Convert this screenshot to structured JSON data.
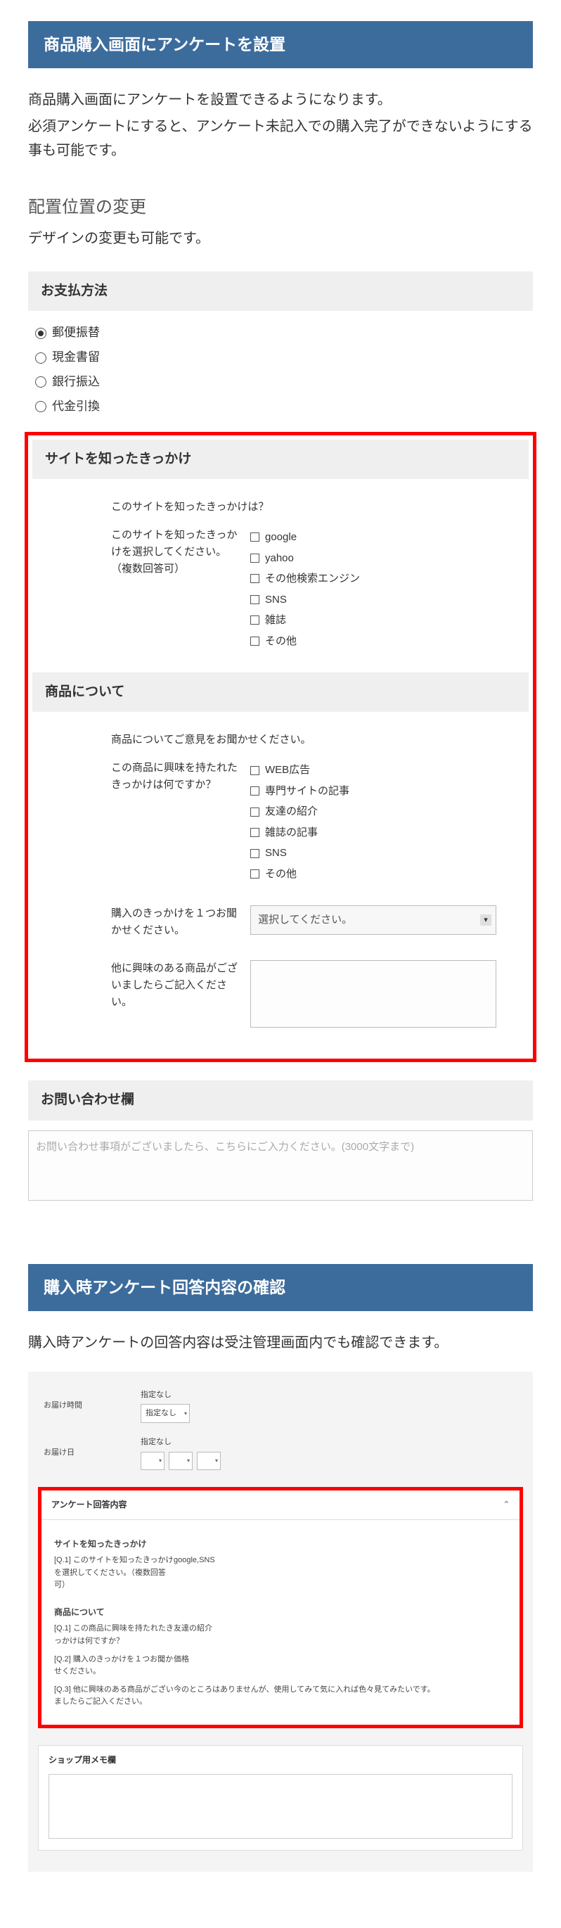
{
  "section1": {
    "title": "商品購入画面にアンケートを設置",
    "p1": "商品購入画面にアンケートを設置できるようになります。",
    "p2": "必須アンケートにすると、アンケート未記入での購入完了ができないようにする事も可能です。",
    "sub_head": "配置位置の変更",
    "sub_desc": "デザインの変更も可能です。"
  },
  "payment": {
    "title": "お支払方法",
    "options": [
      "郵便振替",
      "現金書留",
      "銀行振込",
      "代金引換"
    ],
    "selected_index": 0
  },
  "survey1": {
    "title": "サイトを知ったきっかけ",
    "q1_lead": "このサイトを知ったきっかけは？",
    "q1_label": "このサイトを知ったきっかけを選択してください。（複数回答可）",
    "q1_options": [
      "google",
      "yahoo",
      "その他検索エンジン",
      "SNS",
      "雑誌",
      "その他"
    ]
  },
  "survey2": {
    "title": "商品について",
    "q1_lead": "商品についてご意見をお聞かせください。",
    "q1_label": "この商品に興味を持たれたきっかけは何ですか？",
    "q1_options": [
      "WEB広告",
      "専門サイトの記事",
      "友達の紹介",
      "雑誌の記事",
      "SNS",
      "その他"
    ],
    "q2_label": "購入のきっかけを１つお聞かせください。",
    "q2_select_placeholder": "選択してください。",
    "q3_label": "他に興味のある商品がございましたらご記入ください。"
  },
  "contact": {
    "title": "お問い合わせ欄",
    "placeholder": "お問い合わせ事項がございましたら、こちらにご入力ください。(3000文字まで)"
  },
  "section2": {
    "title": "購入時アンケート回答内容の確認",
    "p1": "購入時アンケートの回答内容は受注管理画面内でも確認できます。"
  },
  "delivery": {
    "time_label": "お届け時間",
    "time_static": "指定なし",
    "time_select": "指定なし",
    "date_label": "お届け日",
    "date_static": "指定なし",
    "date_placeholder": ""
  },
  "admin_survey": {
    "panel_title": "アンケート回答内容",
    "g1_title": "サイトを知ったきっかけ",
    "g1_q1_q": "[Q.1] このサイトを知ったきっかけを選択してください。（複数回答可）",
    "g1_q1_a": "google,SNS",
    "g2_title": "商品について",
    "g2_q1_q": "[Q.1] この商品に興味を持たれたきっかけは何ですか？",
    "g2_q1_a": "友達の紹介",
    "g2_q2_q": "[Q.2] 購入のきっかけを１つお聞かせください。",
    "g2_q2_a": "価格",
    "g2_q3_q": "[Q.3] 他に興味のある商品がございましたらご記入ください。",
    "g2_q3_a": "今のところはありませんが、使用してみて気に入れば色々見てみたいです。"
  },
  "memo": {
    "title": "ショップ用メモ欄"
  }
}
